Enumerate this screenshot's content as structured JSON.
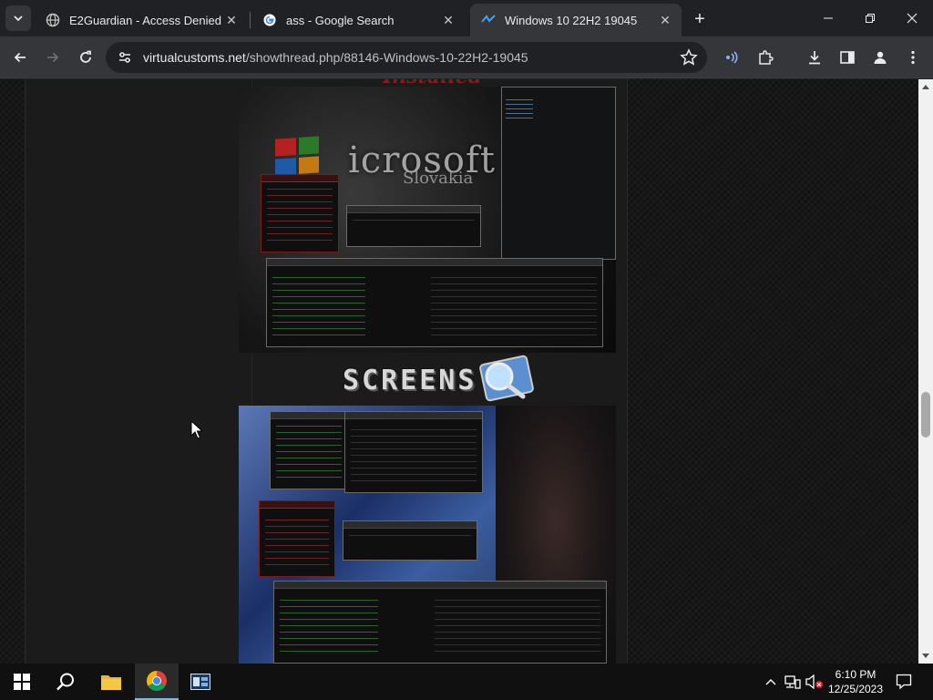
{
  "browser": {
    "tabs": [
      {
        "title": "E2Guardian - Access Denied",
        "icon": "globe-icon",
        "active": false
      },
      {
        "title": "ass - Google Search",
        "icon": "google-icon",
        "active": false
      },
      {
        "title": "Windows 10 22H2 19045",
        "icon": "site-favicon",
        "active": true
      }
    ],
    "new_tab_symbol": "+",
    "address": {
      "host": "virtualcustoms.net",
      "path": "/showthread.php/88146-Windows-10-22H2-19045"
    }
  },
  "page": {
    "installed_heading": "Installed",
    "screens_label": "SCREENS",
    "shot1_brand_text": "icrosoft",
    "shot1_brand_sub": "Slovakia"
  },
  "taskbar": {
    "time": "6:10 PM",
    "date": "12/25/2023"
  },
  "colors": {
    "accent": "#76b9ed",
    "page_bg": "#171717",
    "heading_red": "#8b1a1a"
  }
}
